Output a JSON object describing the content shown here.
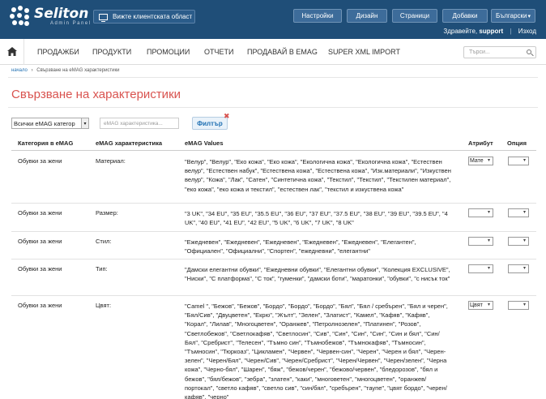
{
  "app": {
    "name": "Seliton",
    "subtitle": "Admin Panel"
  },
  "topbar": {
    "client_area": "Вижте клиентската област",
    "nav": [
      "Настройки",
      "Дизайн",
      "Страници",
      "Добавки",
      "Български"
    ],
    "greeting_prefix": "Здравейте,",
    "user": "support",
    "logout": "Изход"
  },
  "mainnav": {
    "items": [
      "ПРОДАЖБИ",
      "ПРОДУКТИ",
      "ПРОМОЦИИ",
      "ОТЧЕТИ",
      "ПРОДАВАЙ В EMAG",
      "SUPER XML IMPORT"
    ],
    "search_placeholder": "Търси..."
  },
  "breadcrumb": {
    "home": "начало",
    "sep": "›",
    "current": "Свързване на eMAG характеристики"
  },
  "page_title": "Свързване на характеристики",
  "filter": {
    "category_select": "Всички eMAG категор",
    "characteristic_placeholder": "eMAG характеристика...",
    "button": "Филтър"
  },
  "table": {
    "headers": [
      "Категория в eMAG",
      "eMAG характеристика",
      "eMAG Values",
      "Атрибут",
      "Опция"
    ],
    "rows": [
      {
        "category": "Обувки за жени",
        "characteristic": "Материал:",
        "values": "\"Велур\", \"Велур\", \"Еко кожа\", \"Еко кожа\", \"Екологична кожа\", \"Екологична кожа\", \"Естествен велур\", \"Естествен набук\", \"Естествена кожа\", \"Естествена кожа\", \"Изк.материали\", \"Изкуствен велур\", \"Кожа\", \"Лак\", \"Сатен\", \"Синтетична кожа\", \"Текстил\", \"Текстил\", \"Текстилен материал\", \"еко кожа\", \"еко кожа и текстил\", \"естествен лак\", \"текстил и изкуствена кожа\"",
        "attribute": "Мате",
        "option": ""
      },
      {
        "category": "Обувки за жени",
        "characteristic": "Размер:",
        "values": "\"3 UK\", \"34 EU\", \"35 EU\", \"35.5 EU\", \"36 EU\", \"37 EU\", \"37.5 EU\", \"38 EU\", \"39 EU\", \"39.5 EU\", \"4 UK\", \"40 EU\", \"41 EU\", \"42 EU\", \"5 UK\", \"6 UK\", \"7 UK\", \"8 UK\"",
        "attribute": "",
        "option": ""
      },
      {
        "category": "Обувки за жени",
        "characteristic": "Стил:",
        "values": "\"Ежедневен\", \"Ежедневен\", \"Ежедневен\", \"Ежедневен\", \"Ежедневен\", \"Елегантен\", \"Официален\", \"Официални\", \"Спортен\", \"ежедневни\", \"елегантни\"",
        "attribute": "",
        "option": ""
      },
      {
        "category": "Обувки за жени",
        "characteristic": "Тип:",
        "values": "\"Дамски елегантни обувки\", \"Ежедневни обувки\", \"Елегантни обувки\", \"Колекция EXCLUSIVE\", \"Ниски\", \"С платформа\", \"С ток\", \"гуменки\", \"дамски боти\", \"маратонки\", \"обувки\", \"с нисък ток\"",
        "attribute": "",
        "option": ""
      },
      {
        "category": "Обувки за жени",
        "characteristic": "Цвят:",
        "values": "\"Camel \", \"Бежов\", \"Бежов\", \"Бордо\", \"Бордо\", \"Бордо\", \"Бял\", \"Бял / сребърен\", \"Бял и черен\", \"Бял/Сив\", \"Двуцветен\", \"Екрю\", \"Жълт\", \"Зелен\", \"Златист\", \"Камел\", \"Кафяв\", \"Кафяв\", \"Корал\", \"Лилав\", \"Многоцветен\", \"Оранжев\", \"Петролнозелен\", \"Платинен\", \"Розов\", \"Светлобежов\", \"Светлокафяв\", \"Светлосин\", \"Сив\", \"Син\", \"Син\", \"Син\", \"Син и бял\", \"Син/Бял\", \"Сребрист\", \"Телесен\", \"Тъмно син\", \"Тъмнобежов\", \"Тъмнокафяв\", \"Тъмносин\", \"Тъмносин\", \"Тюркоаз\", \"Цикламен\", \"Червен\", \"Червен-син\", \"Черен\", \"Черен и бял\", \"Черен-зелен\", \"Черен/Бял\", \"Черен/Сив\", \"Черен/Сребрист\", \"Черен/Червен\", \"Черен/зелен\", \"Черна кожа\", \"Черно-бял\", \"Шарен\", \"бяж\", \"бежов/черен\", \"бежово/червен\", \"бледорозов\", \"бял и бежов\", \"бял/бежов\", \"зебра\", \"златен\", \"каки\", \"многоветен\", \"многоцветен\", \"оранжев/портокал\", \"светло кафяв\", \"светло сив\", \"син/бял\", \"сребърен\", \"таупе\", \"цвят бордо\", \"черен/кафяв\", \"черно\"",
        "attribute": "Цвят",
        "option": ""
      }
    ]
  },
  "colors": {
    "topbar": "#1f4e78",
    "title": "#d9534f",
    "link": "#1f6fb2"
  }
}
